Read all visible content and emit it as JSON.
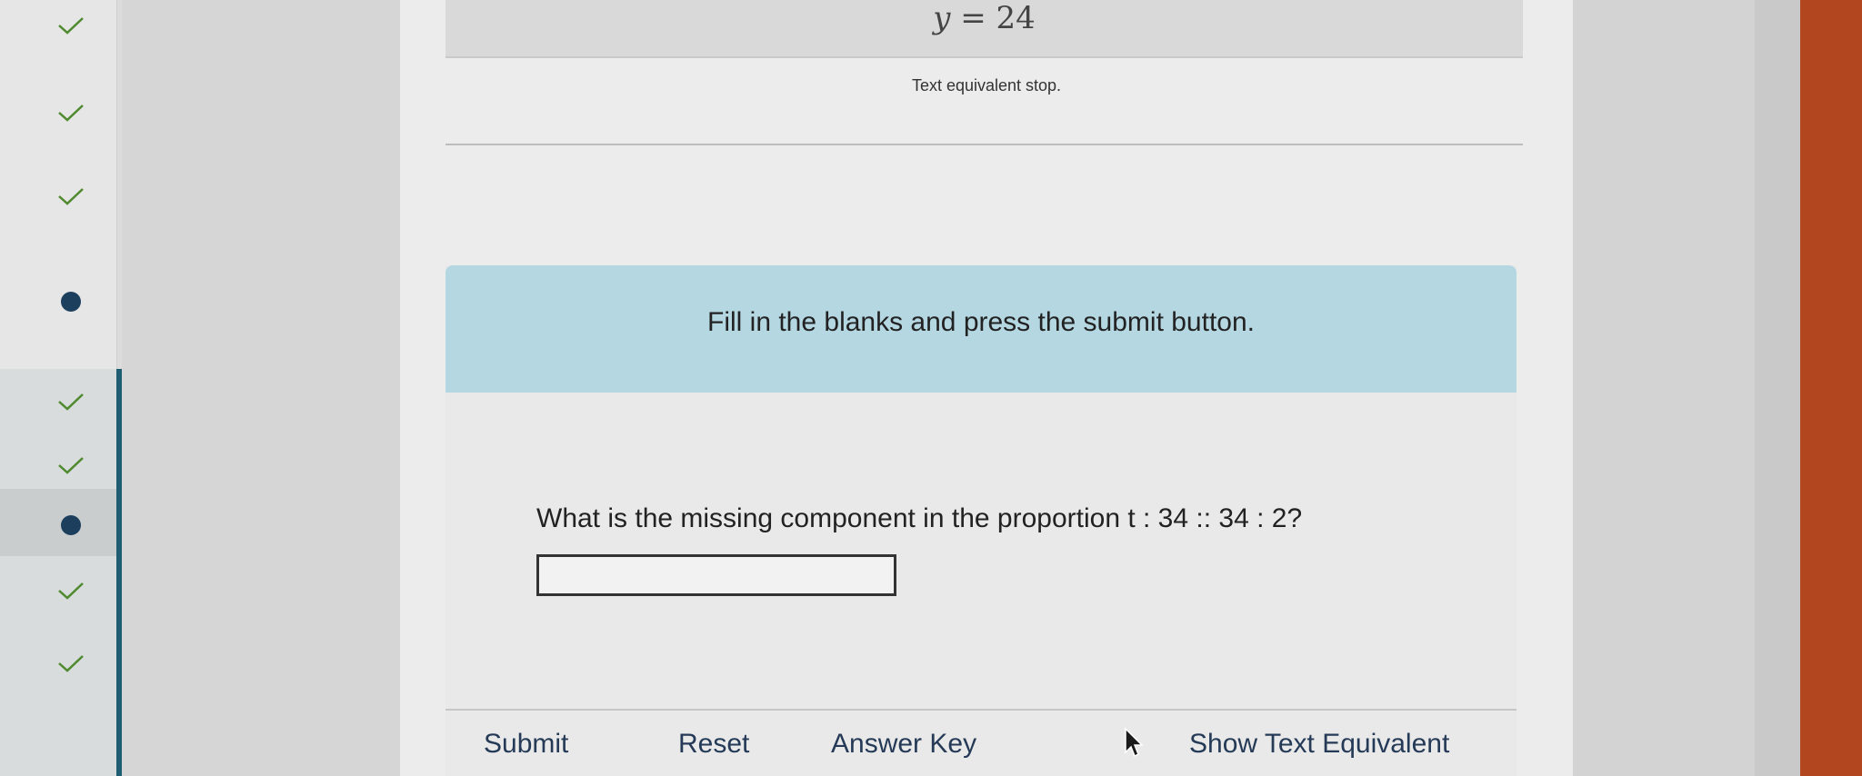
{
  "sidebar": {
    "steps": [
      {
        "status": "complete",
        "icon": "check-icon"
      },
      {
        "status": "complete",
        "icon": "check-icon"
      },
      {
        "status": "complete",
        "icon": "check-icon"
      },
      {
        "status": "in-progress",
        "icon": "progress-dot-icon"
      },
      {
        "status": "complete",
        "icon": "check-icon"
      },
      {
        "status": "complete",
        "icon": "check-icon"
      },
      {
        "status": "in-progress",
        "icon": "progress-dot-icon"
      },
      {
        "status": "complete",
        "icon": "check-icon"
      },
      {
        "status": "complete",
        "icon": "check-icon"
      }
    ]
  },
  "content": {
    "equation": {
      "variable": "y",
      "operator": "=",
      "value": "24"
    },
    "text_equivalent_stop": "Text equivalent stop."
  },
  "question_card": {
    "instructions": "Fill in the blanks and press the submit button.",
    "question": "What is the missing component in the proportion t : 34 :: 34 : 2?",
    "answer": {
      "value": "",
      "placeholder": ""
    },
    "actions": {
      "submit": "Submit",
      "reset": "Reset",
      "answer_key": "Answer Key",
      "show_text_equivalent": "Show Text Equivalent"
    }
  },
  "colors": {
    "header_bg": "#b4d7e2",
    "sidebar_accent": "#1f5d72",
    "link": "#243a57",
    "check": "#4f8a2f",
    "progress_dot": "#1d3f5e"
  }
}
